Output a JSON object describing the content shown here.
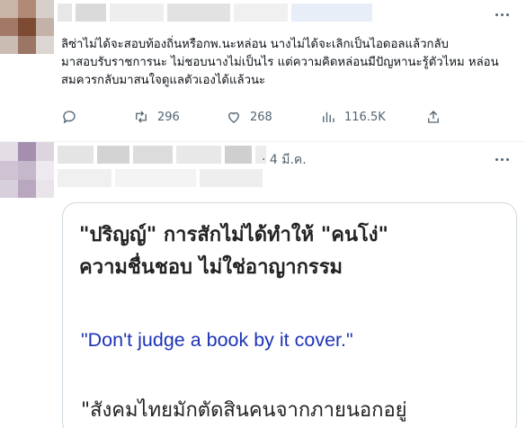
{
  "tweets": [
    {
      "text_lines": [
        "ลิซ่าไม่ได้จะสอบท้องถิ่นหรือกพ.นะหล่อน  นางไม่ได้จะเลิกเป็นไอดอลแล้วกลับ",
        "มาสอบรับราชการนะ ไม่ชอบนางไม่เป็นไร แต่ความคิดหล่อนมีปัญหานะรู้ตัวไหม หล่อน",
        "สมควรกลับมาสนใจดูแลตัวเองได้แล้วนะ"
      ],
      "actions": {
        "reply": {
          "icon": "reply-icon",
          "count": ""
        },
        "retweet": {
          "icon": "retweet-icon",
          "count": "296"
        },
        "like": {
          "icon": "heart-icon",
          "count": "268"
        },
        "views": {
          "icon": "views-icon",
          "count": "116.5K"
        },
        "share": {
          "icon": "share-icon",
          "count": ""
        }
      }
    },
    {
      "date": "· 4 มี.ค.",
      "card": {
        "title_line1": "\"ปริญญ์\" การสักไม่ได้ทำให้ \"คนโง่\"",
        "title_line2": "ความชื่นชอบ ไม่ใช่อาญากรรม",
        "quote": "\"Don't judge a book by it cover.\"",
        "bottom": "\"สังคมไทยมักตัดสินคนจากภายนอกอยู่"
      }
    }
  ],
  "colors": {
    "text": "#0f1419",
    "muted": "#536471",
    "card_border": "#cfd9de",
    "quote_blue": "#1d34b6"
  }
}
